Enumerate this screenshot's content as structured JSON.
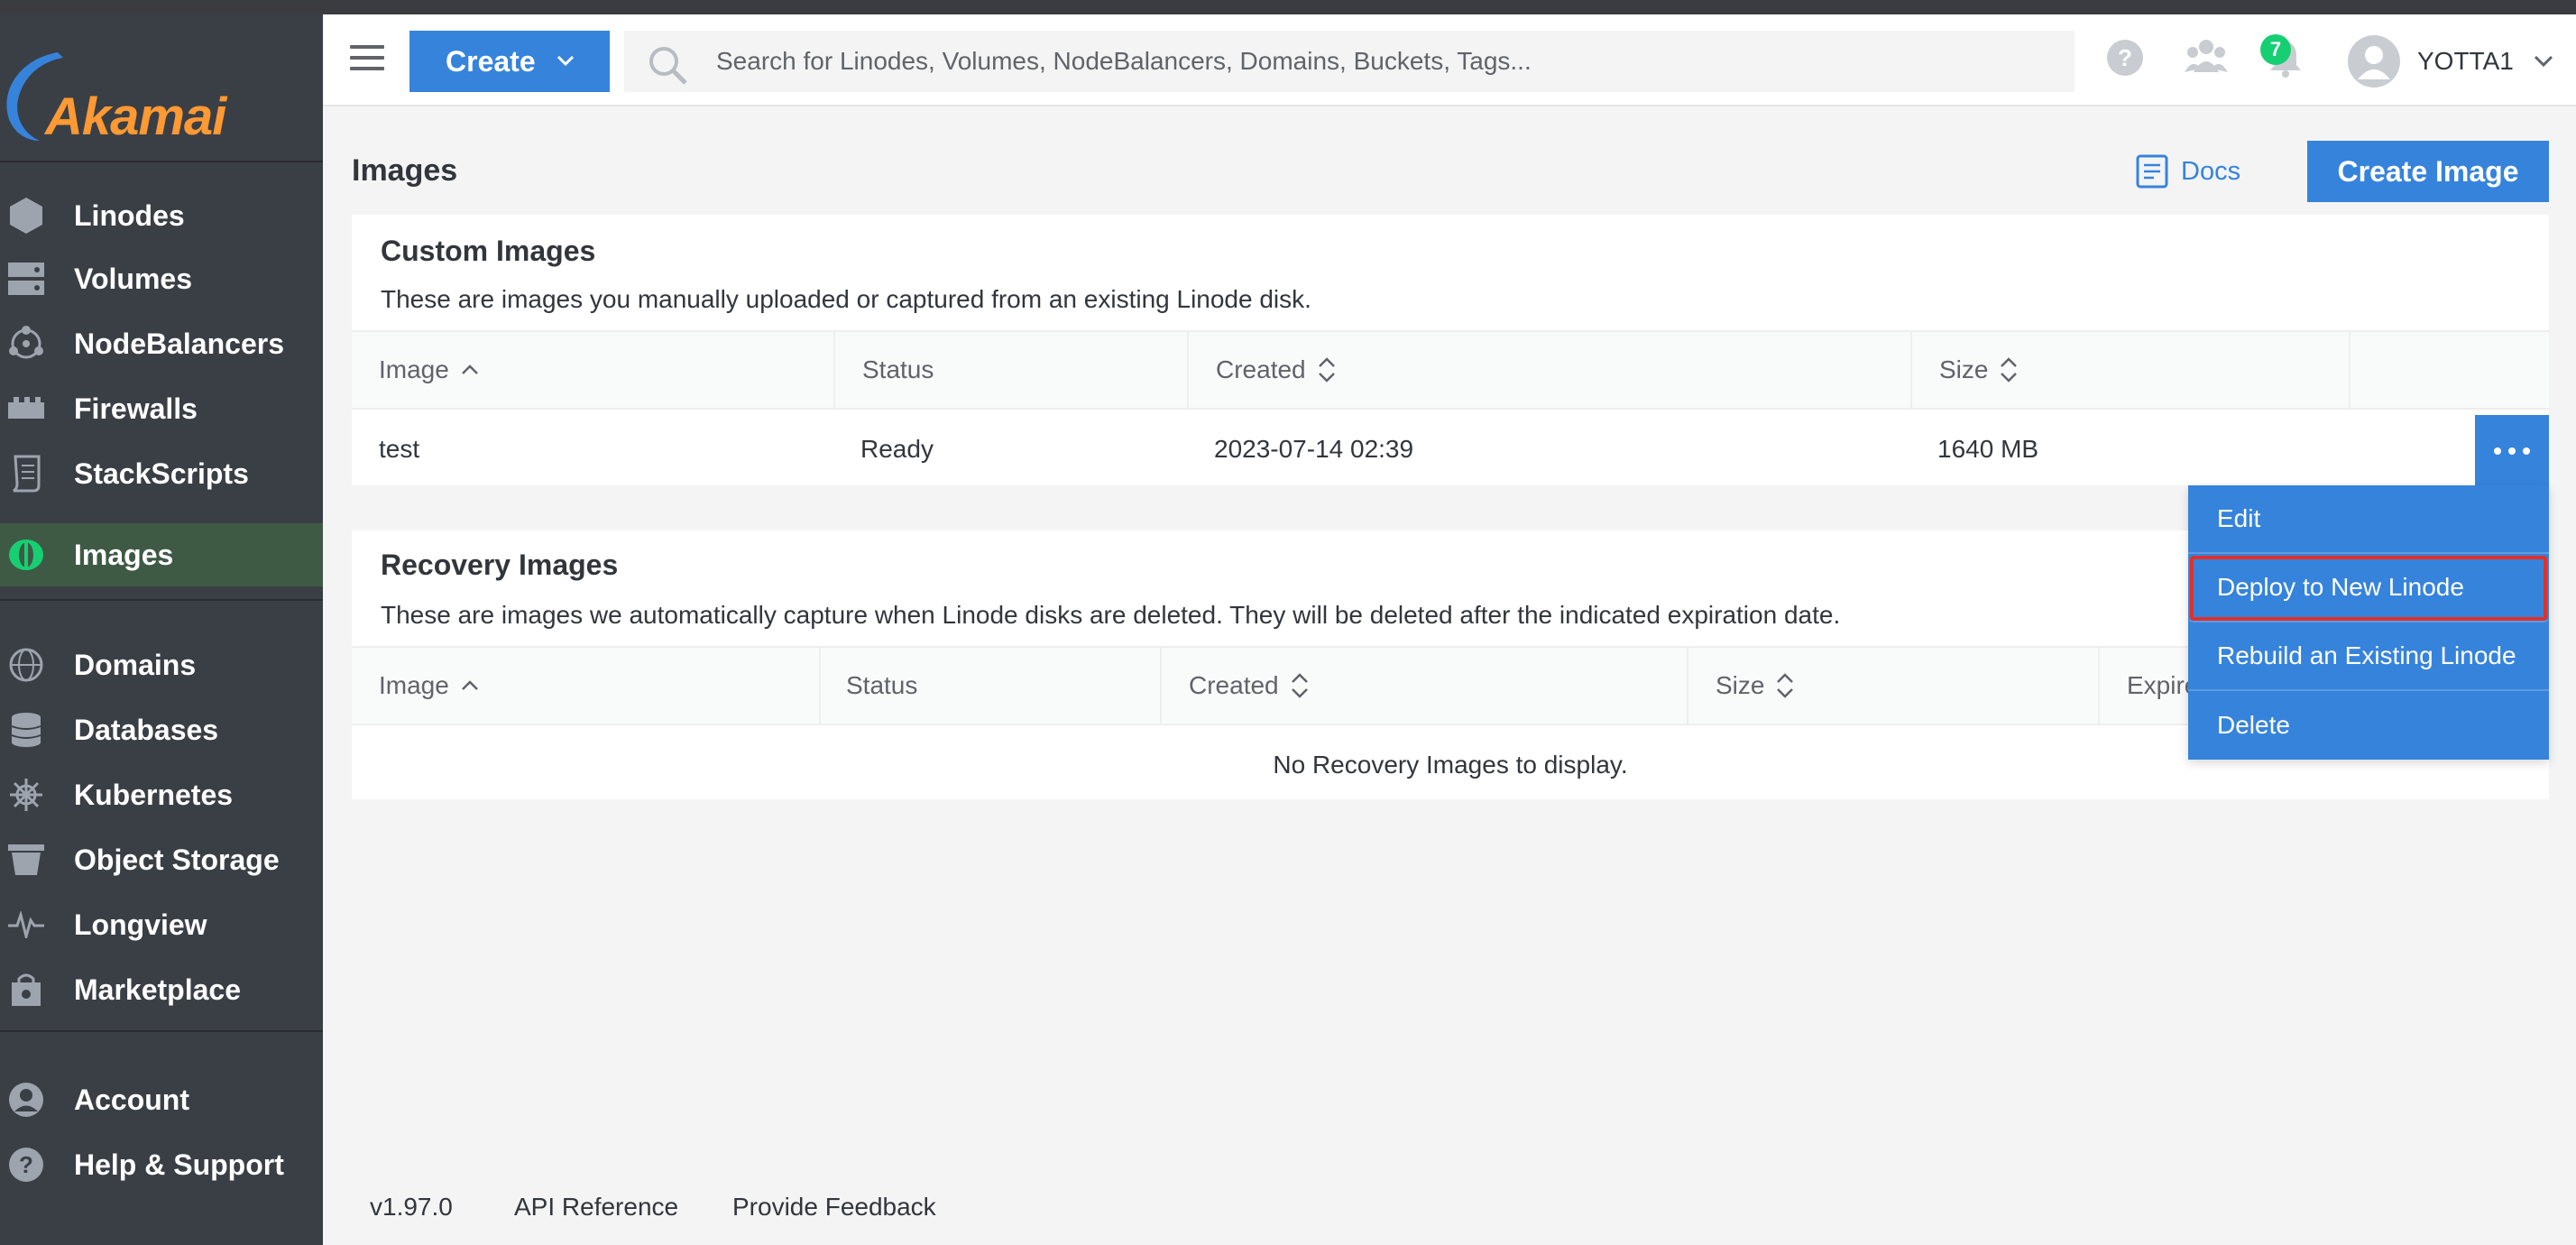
{
  "brand": {
    "name": "Akamai",
    "accent": "#3683dc",
    "sidebar_bg": "#3a3f46",
    "active_bg": "#3e5a45",
    "logo_orange": "#ff9933"
  },
  "sidebar": {
    "groups": [
      [
        {
          "label": "Linodes",
          "icon": "linode-hexagon-icon"
        },
        {
          "label": "Volumes",
          "icon": "volumes-icon"
        },
        {
          "label": "NodeBalancers",
          "icon": "nodebalancer-icon"
        },
        {
          "label": "Firewalls",
          "icon": "firewall-icon"
        },
        {
          "label": "StackScripts",
          "icon": "stackscript-icon"
        },
        {
          "label": "Images",
          "icon": "images-icon",
          "active": true
        }
      ],
      [
        {
          "label": "Domains",
          "icon": "globe-icon"
        },
        {
          "label": "Databases",
          "icon": "database-icon"
        },
        {
          "label": "Kubernetes",
          "icon": "kubernetes-helm-icon"
        },
        {
          "label": "Object Storage",
          "icon": "bucket-icon"
        },
        {
          "label": "Longview",
          "icon": "pulse-icon"
        },
        {
          "label": "Marketplace",
          "icon": "shopping-bag-icon"
        }
      ],
      [
        {
          "label": "Account",
          "icon": "account-icon"
        },
        {
          "label": "Help & Support",
          "icon": "help-icon"
        }
      ]
    ]
  },
  "topbar": {
    "create_label": "Create",
    "search_placeholder": "Search for Linodes, Volumes, NodeBalancers, Domains, Buckets, Tags...",
    "notification_count": "7",
    "username": "YOTTA1"
  },
  "page": {
    "title": "Images",
    "docs_label": "Docs",
    "create_image_label": "Create Image"
  },
  "custom_images": {
    "title": "Custom Images",
    "description": "These are images you manually uploaded or captured from an existing Linode disk.",
    "columns": [
      "Image",
      "Status",
      "Created",
      "Size"
    ],
    "rows": [
      {
        "image": "test",
        "status": "Ready",
        "created": "2023-07-14 02:39",
        "size": "1640 MB"
      }
    ]
  },
  "action_menu": {
    "items": [
      "Edit",
      "Deploy to New Linode",
      "Rebuild an Existing Linode",
      "Delete"
    ],
    "highlighted": "Deploy to New Linode"
  },
  "recovery_images": {
    "title": "Recovery Images",
    "description": "These are images we automatically capture when Linode disks are deleted. They will be deleted after the indicated expiration date.",
    "columns": [
      "Image",
      "Status",
      "Created",
      "Size",
      "Expire"
    ],
    "empty_message": "No Recovery Images to display."
  },
  "footer": {
    "version": "v1.97.0",
    "api_reference": "API Reference",
    "feedback": "Provide Feedback"
  }
}
